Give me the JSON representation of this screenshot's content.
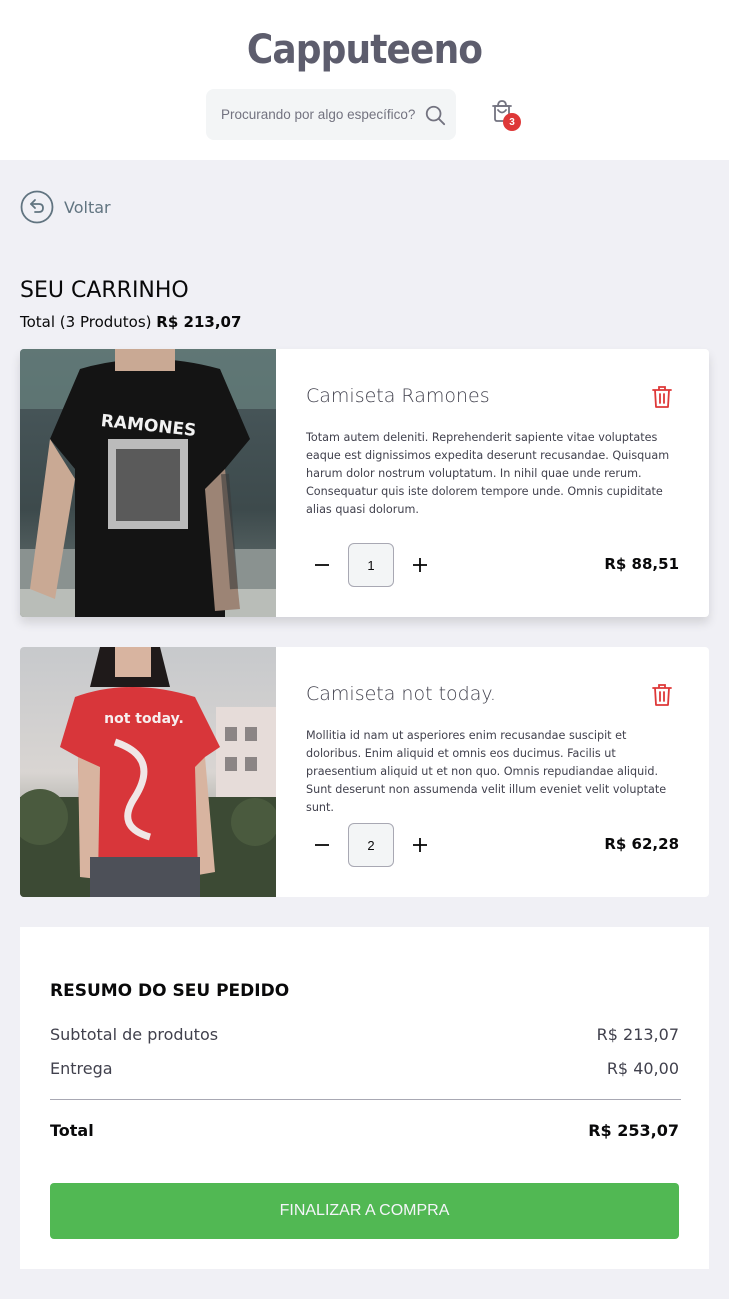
{
  "header": {
    "logo": "Capputeeno",
    "search": {
      "placeholder": "Procurando por algo específico?"
    },
    "cart_count": "3"
  },
  "back": {
    "label": "Voltar"
  },
  "cart": {
    "title": "SEU CARRINHO",
    "total_prefix": "Total (3 Produtos)",
    "total_value": "R$ 213,07",
    "items": [
      {
        "name": "Camiseta Ramones",
        "description": "Totam autem deleniti. Reprehenderit sapiente vitae voluptates eaque est dignissimos expedita deserunt recusandae. Quisquam harum dolor nostrum voluptatum. In nihil quae unde rerum. Consequatur quis iste dolorem tempore unde. Omnis cupiditate alias quasi dolorum.",
        "quantity": "1",
        "price": "R$ 88,51",
        "image_print": "RAMONES"
      },
      {
        "name": "Camiseta not today.",
        "description": "Mollitia id nam ut asperiores enim recusandae suscipit et doloribus. Enim aliquid et omnis eos ducimus. Facilis ut praesentium aliquid ut et non quo. Omnis repudiandae aliquid. Sunt deserunt non assumenda velit illum eveniet velit voluptate sunt.",
        "quantity": "2",
        "price": "R$ 62,28",
        "image_print": "not today."
      }
    ]
  },
  "summary": {
    "title": "RESUMO DO SEU PEDIDO",
    "subtotal_label": "Subtotal de produtos",
    "subtotal_value": "R$ 213,07",
    "shipping_label": "Entrega",
    "shipping_value": "R$ 40,00",
    "total_label": "Total",
    "total_value": "R$ 253,07",
    "checkout_label": "FINALIZAR A COMPRA"
  },
  "colors": {
    "background": "#f0f0f5",
    "accent_green": "#51b853",
    "badge_red": "#de3838",
    "trash_red": "#de3838",
    "logo_gray": "#5d5d6d"
  }
}
